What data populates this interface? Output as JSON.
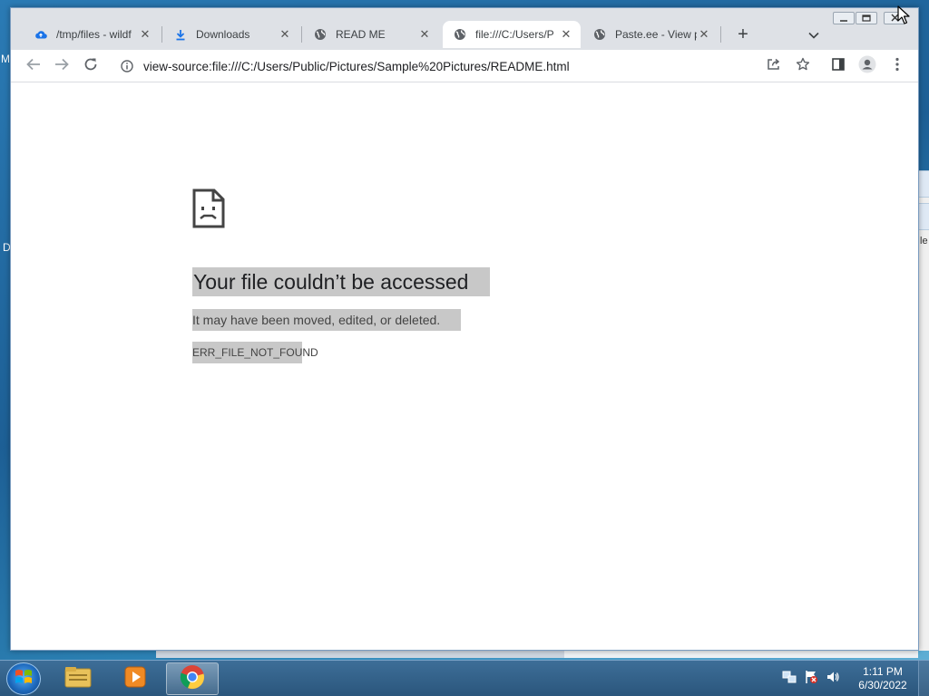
{
  "desktop": {
    "left_fragments": [
      "M",
      "D"
    ],
    "right_fragment": "le"
  },
  "browser": {
    "tabs": [
      {
        "title": "/tmp/files - wildf",
        "icon": "cloud-upload-icon",
        "active": false
      },
      {
        "title": "Downloads",
        "icon": "download-icon",
        "active": false
      },
      {
        "title": "READ ME",
        "icon": "globe-icon",
        "active": false
      },
      {
        "title": "file:///C:/Users/P",
        "icon": "globe-icon",
        "active": true
      },
      {
        "title": "Paste.ee - View p",
        "icon": "globe-icon",
        "active": false
      }
    ],
    "new_tab_symbol": "+",
    "close_symbol": "✕",
    "address": {
      "url": "view-source:file:///C:/Users/Public/Pictures/Sample%20Pictures/README.html"
    }
  },
  "page": {
    "error_title": "Your file couldn’t be accessed",
    "error_description": "It may have been moved, edited, or deleted.",
    "error_code": "ERR_FILE_NOT_FOUND"
  },
  "taskbar": {
    "clock_time": "1:11 PM",
    "clock_date": "6/30/2022",
    "pinned": [
      "explorer-icon",
      "media-player-icon",
      "chrome-icon"
    ]
  },
  "colors": {
    "tabstrip": "#dee1e6",
    "highlight": "#c8c8c8",
    "taskbar": "#2b567c"
  }
}
